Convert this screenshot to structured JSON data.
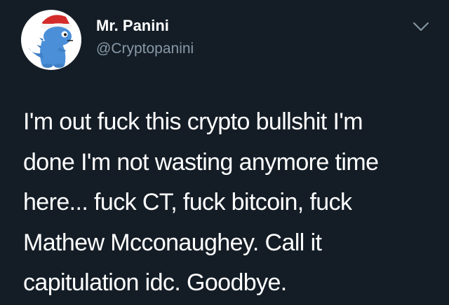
{
  "colors": {
    "background": "#141d26",
    "text": "#ffffff",
    "secondary": "#8899a6"
  },
  "author": {
    "display_name": "Mr. Panini",
    "handle": "@Cryptopanini",
    "avatar_icon": "blue-dinosaur-santa-hat-avatar"
  },
  "menu": {
    "icon": "chevron-down-icon"
  },
  "tweet": {
    "lines": [
      "I'm out fuck this crypto bullshit I'm",
      "done I'm not wasting anymore time",
      "here... fuck CT, fuck bitcoin, fuck",
      "Mathew Mcconaughey. Call it",
      "capitulation idc. Goodbye."
    ]
  }
}
